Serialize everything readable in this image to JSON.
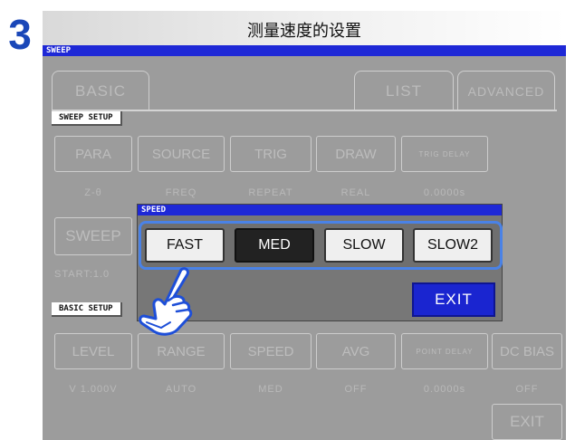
{
  "step": "3",
  "title": "测量速度的设置",
  "screen": {
    "header": "SWEEP",
    "tabs": {
      "basic": "BASIC",
      "list": "LIST",
      "advanced": "ADVANCED"
    },
    "sweep_setup_label": "SWEEP SETUP",
    "basic_setup_label": "BASIC SETUP",
    "sweep_buttons": [
      {
        "label": "PARA",
        "value": "Z-θ"
      },
      {
        "label": "SOURCE",
        "value": "FREQ"
      },
      {
        "label": "TRIG",
        "value": "REPEAT"
      },
      {
        "label": "DRAW",
        "value": "REAL"
      },
      {
        "label": "TRIG DELAY",
        "value": "0.0000s"
      }
    ],
    "sweep_button": "SWEEP",
    "start_text": "START:1.0",
    "basic_buttons": [
      {
        "label": "LEVEL",
        "value": "V 1.000V"
      },
      {
        "label": "RANGE",
        "value": "AUTO"
      },
      {
        "label": "SPEED",
        "value": "MED"
      },
      {
        "label": "AVG",
        "value": "OFF"
      },
      {
        "label": "POINT DELAY",
        "value": "0.0000s"
      },
      {
        "label": "DC BIAS",
        "value": "OFF"
      }
    ],
    "exit_bg": "EXIT"
  },
  "dialog": {
    "header": "SPEED",
    "choices": [
      "FAST",
      "MED",
      "SLOW",
      "SLOW2"
    ],
    "selected": "MED",
    "exit": "EXIT"
  },
  "colors": {
    "step_number": "#1a47b8",
    "header_blue": "#1e28d6",
    "frame_highlight": "#4a82e6",
    "screen_bg": "#9c9c9c"
  },
  "icons": {
    "pointer": "pointing-hand-icon"
  }
}
